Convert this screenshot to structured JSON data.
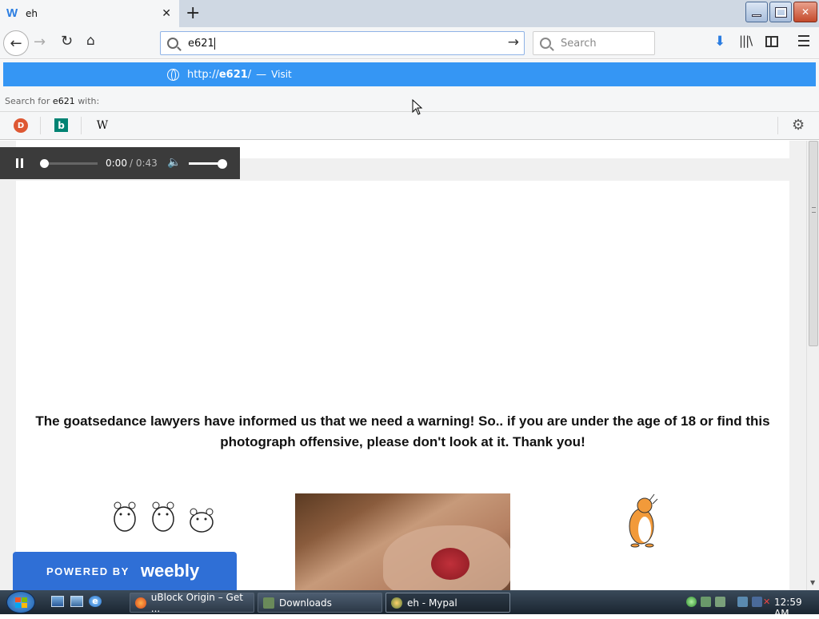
{
  "tab": {
    "title": "eh",
    "favicon": "W"
  },
  "urlbar": {
    "value": "e621"
  },
  "searchbar": {
    "placeholder": "Search"
  },
  "dropdown": {
    "visit_url_prefix": "http://",
    "visit_url_bold": "e621",
    "visit_url_suffix": "/",
    "visit_separator": "—",
    "visit_action": "Visit",
    "search_for_prefix": "Search for",
    "search_term": "e621",
    "search_for_suffix": "with:",
    "engines": [
      "duckduckgo-icon",
      "bing-icon",
      "wikipedia-icon"
    ]
  },
  "audio": {
    "current": "0:00",
    "duration": "/ 0:43",
    "progress": 0,
    "volume": 1.0
  },
  "page": {
    "warning": "The goatsedance lawyers have informed us that we need a warning! So.. if you are under the age of 18 or find this photograph offensive, please don't look at it. Thank you!",
    "badge_powered": "POWERED BY",
    "badge_logo": "weebly"
  },
  "taskbar": {
    "tasks": [
      {
        "label": "uBlock Origin – Get ...",
        "icon": "firefox-icon"
      },
      {
        "label": "Downloads",
        "icon": "folder-icon"
      },
      {
        "label": "eh - Mypal",
        "icon": "mypal-icon"
      }
    ],
    "clock": "12:59 AM"
  },
  "colors": {
    "accent": "#3596f4",
    "weebly": "#2f6fd6",
    "taskbar": "#1f2a36"
  }
}
